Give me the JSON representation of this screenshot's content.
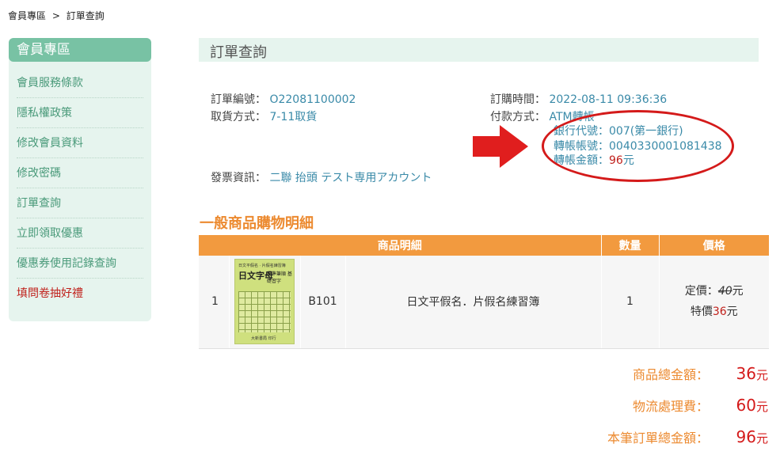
{
  "breadcrumb": {
    "home": "會員專區",
    "sep": ">",
    "current": "訂單查詢"
  },
  "sidebar": {
    "title": "會員專區",
    "items": [
      {
        "label": "會員服務條款"
      },
      {
        "label": "隱私權政策"
      },
      {
        "label": "修改會員資料"
      },
      {
        "label": "修改密碼"
      },
      {
        "label": "訂單查詢"
      },
      {
        "label": "立即領取優惠"
      },
      {
        "label": "優惠券使用記錄查詢"
      },
      {
        "label": "填問卷抽好禮"
      }
    ]
  },
  "page": {
    "title": "訂單查詢"
  },
  "order": {
    "number_label": "訂單編號：",
    "number": "O22081100002",
    "pickup_label": "取貨方式：",
    "pickup": "7-11取貨",
    "time_label": "訂購時間：",
    "time": "2022-08-11 09:36:36",
    "payment_label": "付款方式：",
    "payment": "ATM轉帳",
    "bank_code_label": "銀行代號：",
    "bank_code": "007(第一銀行)",
    "account_label": "轉帳帳號：",
    "account": "0040330001081438",
    "amount_label": "轉帳金額：",
    "amount": "96",
    "amount_unit": "元",
    "invoice_label": "發票資訊：",
    "invoice": "二聯 抬頭 テスト専用アカウント"
  },
  "section": {
    "title": "一般商品購物明細"
  },
  "table": {
    "headers": {
      "detail": "商品明細",
      "qty": "數量",
      "price": "價格"
    },
    "rows": [
      {
        "index": "1",
        "code": "B101",
        "name": "日文平假名．片假名練習簿",
        "qty": "1",
        "list_label": "定價：",
        "list_price": "40",
        "list_unit": "元",
        "sale_label": "特價",
        "sale_price": "36",
        "sale_unit": "元",
        "cover": {
          "top": "日文平假名 · 片假名練習簿",
          "title": "日文字母",
          "sub": "標準筆順 基礎習字",
          "pub": "大新書局 印行"
        }
      }
    ]
  },
  "totals": {
    "subtotal_label": "商品總金額：",
    "subtotal": "36",
    "shipping_label": "物流處理費：",
    "shipping": "60",
    "total_label": "本筆訂單總金額：",
    "total": "96",
    "unit": "元"
  },
  "colors": {
    "accent": "#f29a3f",
    "sidebar": "#78c2a4",
    "link": "#3a8aa8",
    "highlight": "#d41a1a"
  }
}
